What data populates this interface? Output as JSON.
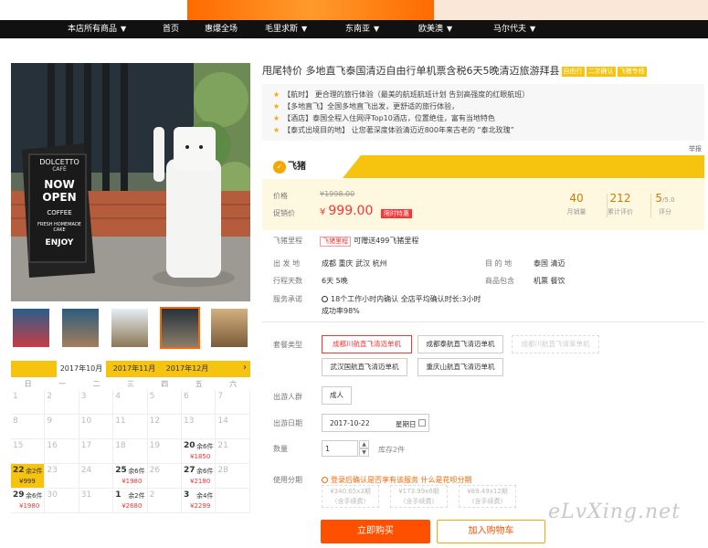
{
  "nav": {
    "items": [
      {
        "label": "本店所有商品",
        "arrow": "▼"
      },
      {
        "label": "首页",
        "arrow": ""
      },
      {
        "label": "惠爆全场",
        "arrow": ""
      },
      {
        "label": "毛里求斯",
        "arrow": "▼"
      },
      {
        "label": "东南亚",
        "arrow": "▼"
      },
      {
        "label": "欧美澳",
        "arrow": "▼"
      },
      {
        "label": "马尔代夫",
        "arrow": "▼"
      }
    ]
  },
  "gallery": {
    "main_image": "DOLCETTO cafe storefront with white statue",
    "sign_lines": [
      "DOLCETTO",
      "CAFÉ",
      "NOW",
      "OPEN",
      "COFFEE",
      "FRESH HOMEMADE CAKE",
      "ENJOY"
    ],
    "thumb_count": 5
  },
  "calendar": {
    "months": [
      "2017年10月",
      "2017年11月",
      "2017年12月"
    ],
    "next_arrow": "›",
    "weekdays": [
      "日",
      "一",
      "二",
      "三",
      "四",
      "五",
      "六"
    ],
    "rows": [
      [
        {
          "d": "1"
        },
        {
          "d": "2"
        },
        {
          "d": "3"
        },
        {
          "d": "4"
        },
        {
          "d": "5"
        },
        {
          "d": "6"
        },
        {
          "d": "7"
        }
      ],
      [
        {
          "d": "8"
        },
        {
          "d": "9"
        },
        {
          "d": "10"
        },
        {
          "d": "11"
        },
        {
          "d": "12"
        },
        {
          "d": "13"
        },
        {
          "d": "14"
        }
      ],
      [
        {
          "d": "15"
        },
        {
          "d": "16"
        },
        {
          "d": "17"
        },
        {
          "d": "18"
        },
        {
          "d": "19"
        },
        {
          "d": "20",
          "rem": "余6件",
          "price": "¥1850"
        },
        {
          "d": "21"
        }
      ],
      [
        {
          "d": "22",
          "rem": "余2件",
          "price": "¥999",
          "selected": true
        },
        {
          "d": "23"
        },
        {
          "d": "24"
        },
        {
          "d": "25",
          "rem": "余6件",
          "price": "¥1980"
        },
        {
          "d": "26"
        },
        {
          "d": "27",
          "rem": "余6件",
          "price": "¥2180"
        },
        {
          "d": "28"
        }
      ],
      [
        {
          "d": "29",
          "rem": "余6件",
          "price": "¥1980"
        },
        {
          "d": "30"
        },
        {
          "d": "31"
        },
        {
          "d": "1",
          "rem": "余2件",
          "price": "¥2680"
        },
        {
          "d": "2"
        },
        {
          "d": "3",
          "rem": "余4件",
          "price": "¥2299"
        },
        {
          "d": ""
        }
      ]
    ]
  },
  "product": {
    "title": "甩尾特价 多地直飞泰国清迈自由行单机票含税6天5晚清迈旅游拜县",
    "tags": [
      "自由行",
      "二次确认",
      "飞猪专线"
    ],
    "features": [
      "【航时】 更合理的旅行体验（最美的航班航班计划 告别高强度的红眼航班）",
      "【多地直飞】全国多地直飞出发，更舒适的旅行体验，",
      "【酒店】泰国全程入住网评Top10酒店，位置绝佳，富有当地特色",
      "【泰式出境目的地】 让您著深度体验清迈近800年来古老的 “泰北玫瑰”"
    ],
    "report": "举报",
    "brand": "飞猪",
    "brand_icon": "pig-logo"
  },
  "price": {
    "label_price": "价格",
    "original": "¥1998.00",
    "label_promo": "促销价",
    "currency": "¥",
    "current": "999.00",
    "promo_tag": "限时特惠",
    "stats": [
      {
        "value": "40",
        "suffix": "",
        "key": "月销量"
      },
      {
        "value": "212",
        "suffix": "",
        "key": "累计评价"
      },
      {
        "value": "5",
        "suffix": "/5.0",
        "key": "评分"
      }
    ]
  },
  "mileage": {
    "label": "飞猪里程",
    "tag": "飞猪里程",
    "text": "可赠送499飞猪里程"
  },
  "info": {
    "depart_label": "出 发 地",
    "depart_value": "成都  重庆  武汉  杭州",
    "dest_label": "目 的 地",
    "dest_value": "泰国  清迈",
    "days_label": "行程天数",
    "days_value": "6天  5晚",
    "includes_label": "商品包含",
    "includes_value": "机票  餐饮",
    "service_label": "服务承诺",
    "service_line1": "18个工作小时内确认 全店平均确认时长:3小时",
    "service_line2": "成功率98%"
  },
  "options": {
    "package_label": "套餐类型",
    "packages": [
      {
        "label": "成都川航直飞清迈单机",
        "state": "sel"
      },
      {
        "label": "成都泰航直飞清迈单机",
        "state": ""
      },
      {
        "label": "成都川航直飞清莱单机",
        "state": "dis"
      },
      {
        "label": "武汉国航直飞清迈单机",
        "state": ""
      },
      {
        "label": "重庆山航直飞清迈单机",
        "state": ""
      }
    ],
    "crowd_label": "出游人群",
    "crowd_value": "成人",
    "date_label": "出游日期",
    "date_value": "2017-10-22",
    "weekday_value": "星期日",
    "qty_label": "数量",
    "qty_value": "1",
    "qty_up": "▲",
    "qty_down": "▼",
    "stock": "库存2件",
    "installment_label": "使用分期",
    "installment_note": "登录后确认是否享有该服务 什么是花呗分期",
    "installments": [
      {
        "line1": "¥340.65x3期",
        "line2": "(含手续费)"
      },
      {
        "line1": "¥173.99x6期",
        "line2": "(含手续费)"
      },
      {
        "line1": "¥89.49x12期",
        "line2": "(含手续费)"
      }
    ]
  },
  "actions": {
    "buy": "立即购买",
    "cart": "加入购物车"
  },
  "watermark": "eLvXing.net"
}
